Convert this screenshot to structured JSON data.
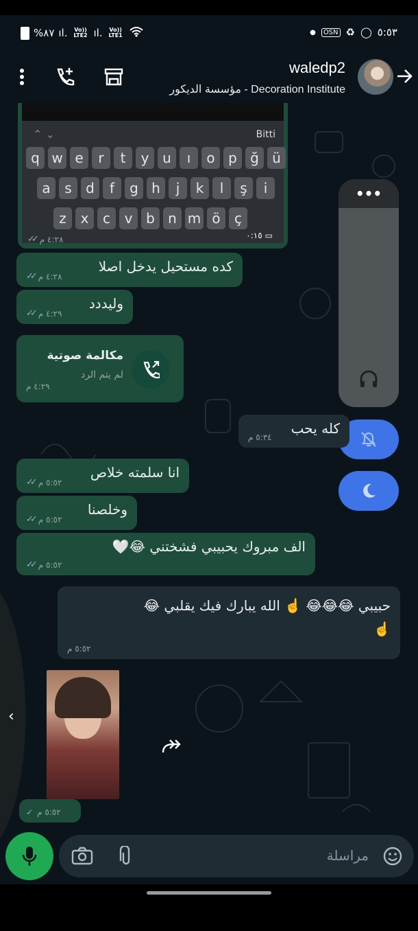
{
  "status_bar": {
    "battery": "%٨٧",
    "sim1": "Vo)) LTE2",
    "sim2": "Vo)) LTE1",
    "time": "٥:٥٣"
  },
  "header": {
    "title": "waledp2",
    "subtitle": "مؤسسة الديكور - Decoration Institute"
  },
  "keyboard_screenshot": {
    "done_label": "Bitti",
    "row1": [
      "q",
      "w",
      "e",
      "r",
      "t",
      "y",
      "u",
      "ı",
      "o",
      "p",
      "ğ",
      "ü"
    ],
    "row2": [
      "a",
      "s",
      "d",
      "f",
      "g",
      "h",
      "j",
      "k",
      "l",
      "ş",
      "i"
    ],
    "row3": [
      "z",
      "x",
      "c",
      "v",
      "b",
      "n",
      "m",
      "ö",
      "ç"
    ],
    "video_time": "٠:١٥",
    "time": "٤:٢٨ م"
  },
  "messages": [
    {
      "text": "كده مستحيل يدخل اصلا",
      "time": "٤:٢٨ م"
    },
    {
      "text": "وليددد",
      "time": "٤:٢٩ م"
    },
    {
      "title": "مكالمة صوتية",
      "sub": "لم يتم الرد",
      "time": "٤:٢٩ م"
    },
    {
      "text": "كله يحب",
      "time": "٥:٣٤ م"
    },
    {
      "text": "انا سلمته خلاص",
      "time": "٥:٥٢ م"
    },
    {
      "text": "وخلصنا",
      "time": "٥:٥٢ م"
    },
    {
      "text": "الف مبروك يحبيبي فشختني 😂🤍",
      "time": "٥:٥٢ م"
    },
    {
      "text": "حبيبي 😂😂😂 ☝️ الله يبارك فيك يقلبي 😂",
      "text2": "☝️",
      "time": "٥:٥٢ م"
    },
    {
      "time": "٥:٥٢ م"
    }
  ],
  "composer": {
    "placeholder": "مراسلة"
  }
}
